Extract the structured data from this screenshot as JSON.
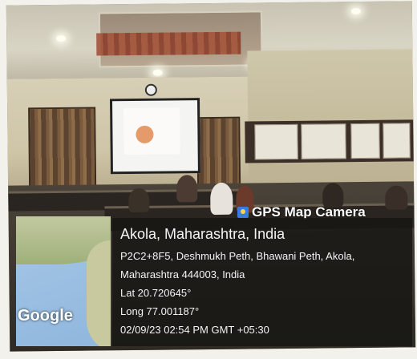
{
  "overlay": {
    "brand": "GPS Map Camera",
    "location_title": "Akola, Maharashtra, India",
    "address_line1": "P2C2+8F5, Deshmukh Peth, Bhawani Peth, Akola,",
    "address_line2": "Maharashtra 444003, India",
    "latitude": "Lat 20.720645°",
    "longitude": "Long 77.001187°",
    "timestamp": "02/09/23 02:54 PM GMT +05:30",
    "map_label": "Google"
  },
  "colors": {
    "overlay_bg": "#161614",
    "brand_icon": "#3b7be0",
    "map_water": "#8fb6dd",
    "map_land": "#a9b782"
  },
  "icons": {
    "brand_icon": "map-pin-icon"
  }
}
